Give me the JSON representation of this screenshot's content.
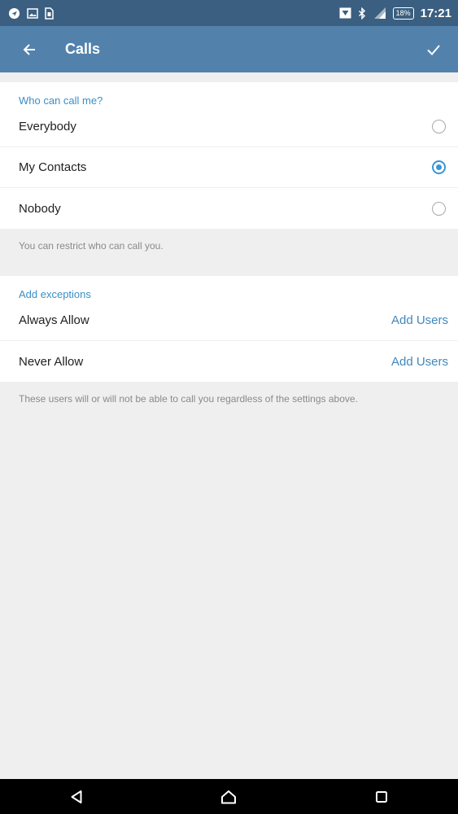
{
  "status_bar": {
    "time": "17:21",
    "battery": "18%",
    "icons": [
      "navigation-icon",
      "image-icon",
      "sim-icon",
      "download-icon",
      "bluetooth-icon",
      "signal-icon",
      "battery-icon"
    ]
  },
  "toolbar": {
    "title": "Calls",
    "back_icon": "arrow-left-icon",
    "done_icon": "checkmark-icon"
  },
  "privacy": {
    "header": "Who can call me?",
    "options": [
      {
        "label": "Everybody",
        "checked": false
      },
      {
        "label": "My Contacts",
        "checked": true
      },
      {
        "label": "Nobody",
        "checked": false
      }
    ],
    "hint": "You can restrict who can call you."
  },
  "exceptions": {
    "header": "Add exceptions",
    "rows": [
      {
        "label": "Always Allow",
        "action": "Add Users"
      },
      {
        "label": "Never Allow",
        "action": "Add Users"
      }
    ],
    "hint": "These users will or will not be able to call you regardless of the settings above."
  },
  "colors": {
    "status_bar": "#3b5f80",
    "toolbar": "#5282ac",
    "accent": "#3a95d5",
    "link": "#4088bd"
  }
}
